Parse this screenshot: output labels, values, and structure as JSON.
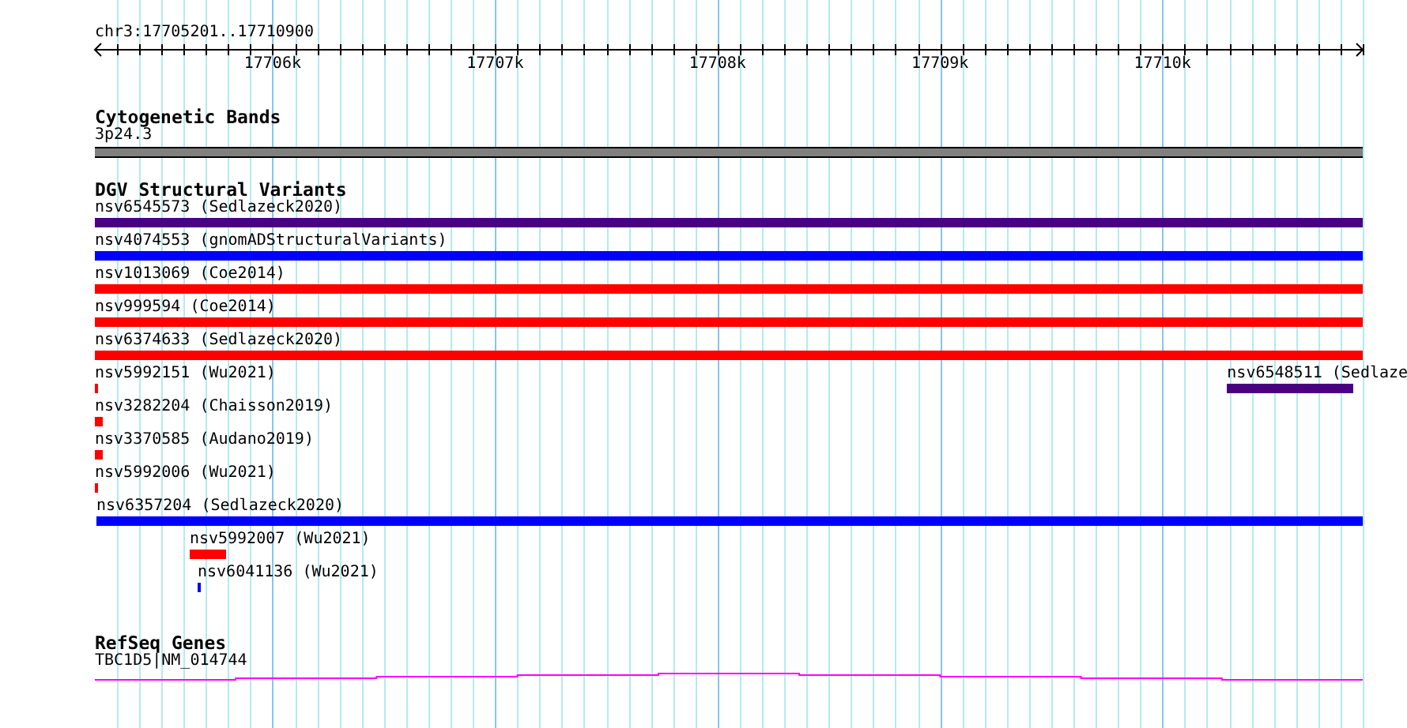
{
  "location": "chr3:17705201..17710900",
  "ruler": {
    "ticks": [
      {
        "label": "17706k"
      },
      {
        "label": "17707k"
      },
      {
        "label": "17708k"
      },
      {
        "label": "17709k"
      },
      {
        "label": "17710k"
      }
    ]
  },
  "tracks": [
    {
      "kind": "cytoband",
      "title": "Cytogenetic Bands",
      "rows": [
        [
          {
            "label": "3p24.3",
            "color": "#808080"
          }
        ]
      ]
    },
    {
      "kind": "variants",
      "title": "DGV Structural Variants",
      "rows": [
        [
          {
            "label": "nsv6545573 (Sedlazeck2020)",
            "color": "#4b0082"
          }
        ],
        [
          {
            "label": "nsv4074553 (gnomADStructuralVariants)",
            "color": "#0000ff"
          }
        ],
        [
          {
            "label": "nsv1013069 (Coe2014)",
            "color": "#ff0000"
          }
        ],
        [
          {
            "label": "nsv999594 (Coe2014)",
            "color": "#ff0000"
          }
        ],
        [
          {
            "label": "nsv6374633 (Sedlazeck2020)",
            "color": "#ff0000"
          }
        ],
        [
          {
            "label": "nsv5992151 (Wu2021)",
            "color": "#ff0000"
          },
          {
            "label": "nsv6548511 (Sedlaze",
            "color": "#4b0082"
          }
        ],
        [
          {
            "label": "nsv3282204 (Chaisson2019)",
            "color": "#ff0000"
          }
        ],
        [
          {
            "label": "nsv3370585 (Audano2019)",
            "color": "#ff0000"
          }
        ],
        [
          {
            "label": "nsv5992006 (Wu2021)",
            "color": "#ff0000"
          }
        ],
        [
          {
            "label": "nsv6357204 (Sedlazeck2020)",
            "color": "#0000ff"
          }
        ],
        [
          {
            "label": "nsv5992007 (Wu2021)",
            "color": "#ff0000"
          }
        ],
        [
          {
            "label": "nsv6041136 (Wu2021)",
            "color": "#0000ff"
          }
        ]
      ]
    },
    {
      "kind": "gene",
      "title": "RefSeq Genes",
      "rows": [
        [
          {
            "label": "TBC1D5|NM_014744",
            "color": "#ff00ff"
          }
        ]
      ]
    }
  ]
}
